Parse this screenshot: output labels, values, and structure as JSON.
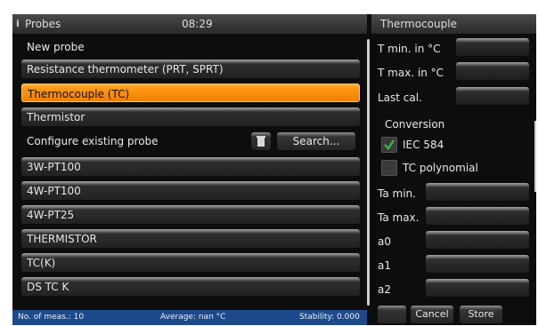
{
  "left_header": {
    "title": "Probes",
    "clock": "08:29"
  },
  "right_header": {
    "title": "Thermocouple"
  },
  "new_probe": {
    "heading": "New probe",
    "items": [
      "Resistance thermometer (PRT, SPRT)",
      "Thermocouple (TC)",
      "Thermistor"
    ],
    "selected": "Thermocouple (TC)"
  },
  "existing": {
    "heading": "Configure existing probe",
    "search_label": "Search...",
    "items": [
      "3W-PT100",
      "4W-PT100",
      "4W-PT25",
      "THERMISTOR",
      "TC(K)",
      "DS TC K"
    ]
  },
  "props": {
    "tmin": "T min. in °C",
    "tmax": "T max. in °C",
    "lastcal": "Last cal.",
    "conversion": "Conversion",
    "iec_label": "IEC 584",
    "iec_checked": true,
    "poly_label": "TC polynomial",
    "poly_checked": false,
    "ta_min": "Ta min.",
    "ta_max": "Ta max.",
    "a0": "a0",
    "a1": "a1",
    "a2": "a2"
  },
  "buttons": {
    "cancel": "Cancel",
    "store": "Store"
  },
  "status": {
    "meas": "No. of meas.: 10",
    "avg": "Average: nan °C",
    "stab": "Stability: 0.000"
  },
  "colors": {
    "selected": "#f08000",
    "status_bar": "#1d4a8a",
    "check": "#3fae3f"
  }
}
